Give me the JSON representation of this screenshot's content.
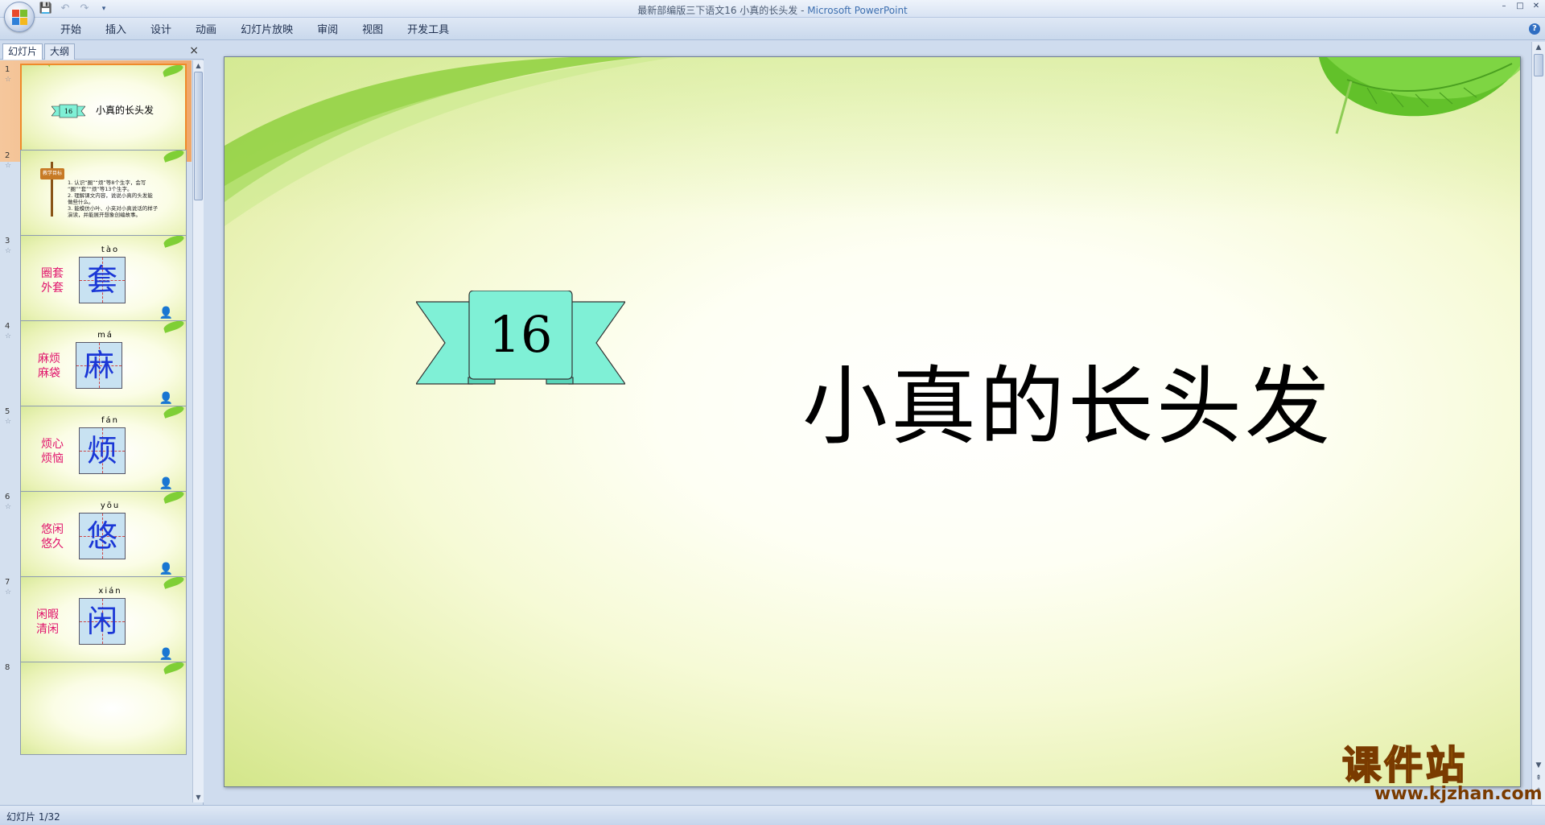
{
  "window": {
    "title": "最新部编版三下语文16 小真的长头发 - ",
    "app_name": "Microsoft PowerPoint",
    "controls": [
      "–",
      "□",
      "✕"
    ]
  },
  "quick_access": {
    "icons": [
      "save-icon",
      "undo-icon",
      "redo-icon",
      "customize-icon"
    ]
  },
  "ribbon": {
    "tabs": [
      "开始",
      "插入",
      "设计",
      "动画",
      "幻灯片放映",
      "审阅",
      "视图",
      "开发工具"
    ],
    "help": "?"
  },
  "left_pane": {
    "tabs": [
      "幻灯片",
      "大纲"
    ],
    "close": "×",
    "slides": [
      {
        "num": "1",
        "kind": "title",
        "badge": "16",
        "title": "小真的长头发"
      },
      {
        "num": "2",
        "kind": "goals",
        "sign": "教学目标",
        "lines": [
          "1. 认识“圈”“烦”等8个生字，会写",
          "“圈”“套”“烦”等13个生字。",
          "2. 理解课文内容，说说小真的头发能",
          "做些什么。",
          "3. 能模仿小叶、小夹对小真说话的样子",
          "演读，并能展开想象创编故事。"
        ]
      },
      {
        "num": "3",
        "kind": "char",
        "pinyin": "tào",
        "char": "套",
        "words": [
          "圈套",
          "外套"
        ]
      },
      {
        "num": "4",
        "kind": "char",
        "pinyin": "má",
        "char": "麻",
        "words": [
          "麻烦",
          "麻袋"
        ]
      },
      {
        "num": "5",
        "kind": "char",
        "pinyin": "fán",
        "char": "烦",
        "words": [
          "烦心",
          "烦恼"
        ]
      },
      {
        "num": "6",
        "kind": "char",
        "pinyin": "yōu",
        "char": "悠",
        "words": [
          "悠闲",
          "悠久"
        ]
      },
      {
        "num": "7",
        "kind": "char",
        "pinyin": "xián",
        "char": "闲",
        "words": [
          "闲暇",
          "清闲"
        ]
      },
      {
        "num": "8",
        "kind": "partial"
      }
    ]
  },
  "slide": {
    "number_badge": "16",
    "title": "小真的长头发"
  },
  "watermark": {
    "text": "课件站",
    "url": "www.kjzhan.com"
  },
  "status": {
    "text": "幻灯片 1/32"
  },
  "colors": {
    "banner_fill": "#7ff0d6",
    "leaf_green": "#62c12a",
    "accent_orange": "#ef8a2a",
    "word_pink": "#e0126b",
    "char_blue": "#1a37d6"
  }
}
